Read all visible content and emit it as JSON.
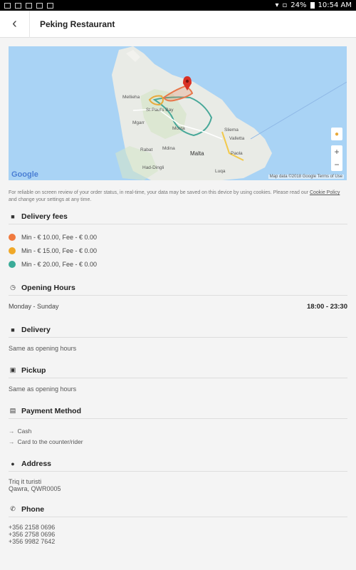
{
  "status_bar": {
    "battery": "24%",
    "time": "10:54 AM"
  },
  "app_bar": {
    "title": "Peking Restaurant"
  },
  "map": {
    "labels": {
      "mellieha": "Mellieha",
      "st_pauls_bay": "St Paul's Bay",
      "mgarr": "Mgarr",
      "mosta": "Mosta",
      "rabat": "Rabat",
      "mdina": "Mdina",
      "malta": "Malta",
      "sliema": "Sliema",
      "valletta": "Valletta",
      "paola": "Paola",
      "luqa": "Luqa",
      "had_dingli": "Had-Dingli"
    },
    "google": "Google",
    "credit": "Map data ©2018 Google   Terms of Use",
    "zoom_in": "+",
    "zoom_out": "−",
    "zone_colors": [
      "#e8764a",
      "#e8a93a",
      "#48a899"
    ]
  },
  "cookie_notice": {
    "text_before": "For reliable on screen review of your order status, in real-time, your data may be saved on this device by using cookies. Please read our ",
    "link": "Cookie Policy",
    "text_after": " and change your settings at any time."
  },
  "delivery_fees": {
    "title": "Delivery fees",
    "items": [
      {
        "text": "Min - € 10.00, Fee - € 0.00",
        "color": "#f07a3e"
      },
      {
        "text": "Min - € 15.00, Fee - € 0.00",
        "color": "#f0a828"
      },
      {
        "text": "Min - € 20.00, Fee - € 0.00",
        "color": "#3aab98"
      }
    ]
  },
  "opening_hours": {
    "title": "Opening Hours",
    "days": "Monday - Sunday",
    "time": "18:00 - 23:30"
  },
  "delivery": {
    "title": "Delivery",
    "text": "Same as opening hours"
  },
  "pickup": {
    "title": "Pickup",
    "text": "Same as opening hours"
  },
  "payment": {
    "title": "Payment Method",
    "items": [
      "Cash",
      "Card to the counter/rider"
    ]
  },
  "address": {
    "title": "Address",
    "line1": "Triq it turisti",
    "line2": "Qawra, QWR0005"
  },
  "phone": {
    "title": "Phone",
    "numbers": [
      "+356 2158 0696",
      "+356 2758 0696",
      "+356 9982 7642"
    ]
  }
}
